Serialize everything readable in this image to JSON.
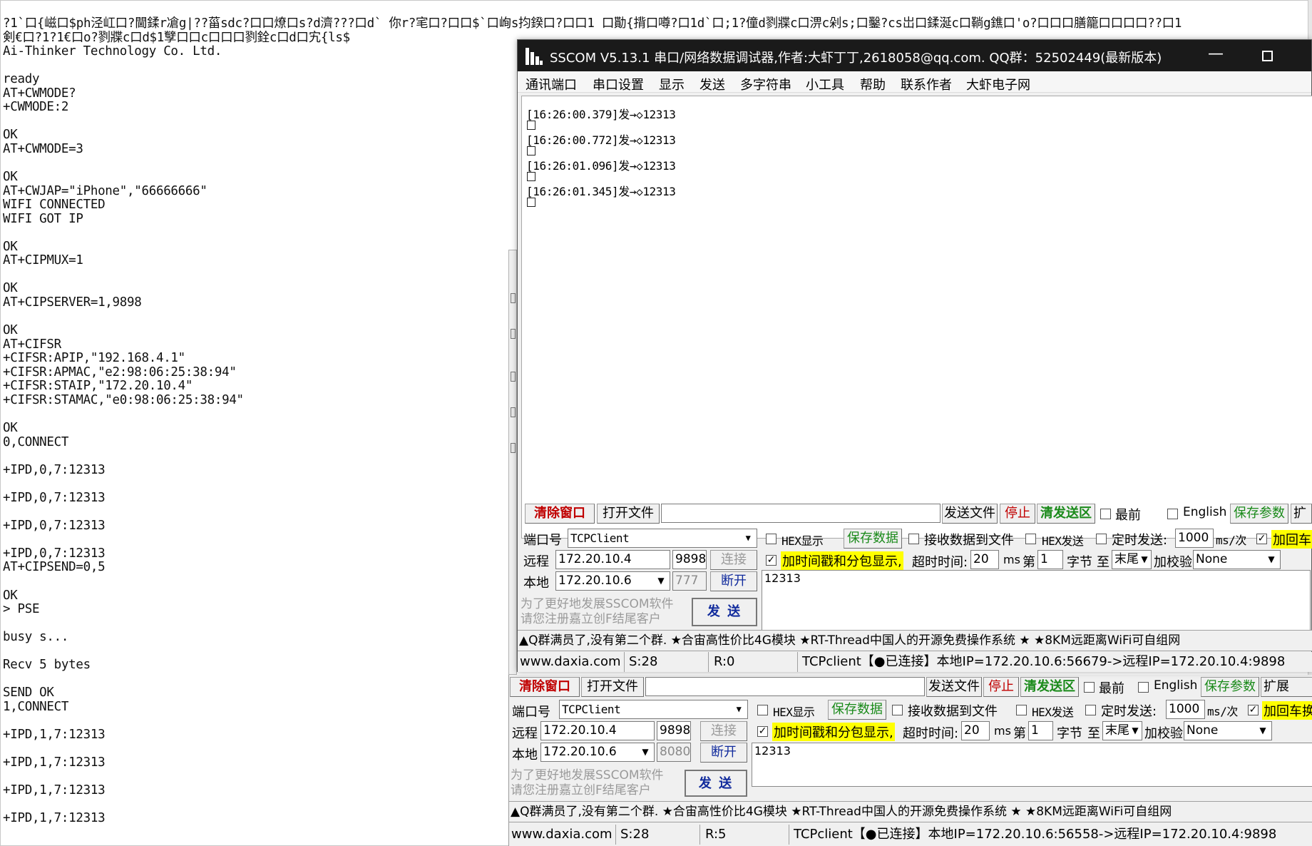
{
  "bg_log": {
    "lines": [
      "?1`口{嵫口$ph泾屸口?閫鍒r凔g|??菑sdc?口口燎口s?d濟???口d` 你r?宒口?口口$`口峋s抣鍨口?口口1 口勩{揹口噂?口1d`口;1?僮d剹牃c口淠c剁s;口鑿?cs岀口鍒涎c口鞝g鐎口'o?口口口膳籠口口口口??口1",
      "剣€口?1?1€口o?剹牃c口d$1孼口口c口口口剹銓c口d口宄{ls$",
      "Ai-Thinker Technology Co. Ltd.",
      "",
      "ready",
      "AT+CWMODE?",
      "+CWMODE:2",
      "",
      "OK",
      "AT+CWMODE=3",
      "",
      "OK",
      "AT+CWJAP=\"iPhone\",\"66666666\"",
      "WIFI CONNECTED",
      "WIFI GOT IP",
      "",
      "OK",
      "AT+CIPMUX=1",
      "",
      "OK",
      "AT+CIPSERVER=1,9898",
      "",
      "OK",
      "AT+CIFSR",
      "+CIFSR:APIP,\"192.168.4.1\"",
      "+CIFSR:APMAC,\"e2:98:06:25:38:94\"",
      "+CIFSR:STAIP,\"172.20.10.4\"",
      "+CIFSR:STAMAC,\"e0:98:06:25:38:94\"",
      "",
      "OK",
      "0,CONNECT",
      "",
      "+IPD,0,7:12313",
      "",
      "+IPD,0,7:12313",
      "",
      "+IPD,0,7:12313",
      "",
      "+IPD,0,7:12313",
      "AT+CIPSEND=0,5",
      "",
      "OK",
      "> PSE",
      "",
      "busy s...",
      "",
      "Recv 5 bytes",
      "",
      "SEND OK",
      "1,CONNECT",
      "",
      "+IPD,1,7:12313",
      "",
      "+IPD,1,7:12313",
      "",
      "+IPD,1,7:12313",
      "",
      "+IPD,1,7:12313"
    ]
  },
  "sscom": {
    "title": "SSCOM V5.13.1 串口/网络数据调试器,作者:大虾丁丁,2618058@qq.com. QQ群：52502449(最新版本)",
    "minimize_glyph": "—",
    "menu": [
      "通讯端口",
      "串口设置",
      "显示",
      "发送",
      "多字符串",
      "小工具",
      "帮助",
      "联系作者",
      "大虾电子网"
    ],
    "recv_lines": [
      "[16:26:00.379]发→◇12313",
      "[16:26:00.772]发→◇12313",
      "[16:26:01.096]发→◇12313",
      "[16:26:01.345]发→◇12313"
    ],
    "clear_label": "清除窗口",
    "open_file_label": "打开文件",
    "send_file_label": "发送文件",
    "stop_label": "停止",
    "clear_send_label": "清发送区",
    "topmost_label": "最前",
    "english_label": "English",
    "save_params_label": "保存参数",
    "expand_label": "扩",
    "port_label": "端口号",
    "port_value": "TCPClient",
    "hex_show_label": "HEX显示",
    "save_data_label": "保存数据",
    "recv_to_file_label": "接收数据到文件",
    "hex_send_label": "HEX发送",
    "timed_send_label": "定时发送:",
    "interval_value": "1000",
    "interval_unit": "ms/次",
    "add_crlf_label": "加回车",
    "remote_label": "远程",
    "remote_ip": "172.20.10.4",
    "remote_port": "9898",
    "connect_label": "连接",
    "timestamp_label": "加时间戳和分包显示,",
    "timeout_label": "超时时间:",
    "timeout_value": "20",
    "timeout_unit": "ms",
    "nth_label": "第",
    "nth_value": "1",
    "byte_label": "字节",
    "to_label": "至",
    "end_value": "末尾",
    "checksum_label": "加校验",
    "checksum_value": "None",
    "local_label": "本地",
    "local_ip": "172.20.10.6",
    "local_port": "777",
    "disconnect_label": "断开",
    "send_text": "12313",
    "ad_line1": "为了更好地发展SSCOM软件",
    "ad_line2": "请您注册嘉立创F结尾客户",
    "send_label": "发 送",
    "news": "▲Q群满员了,没有第二个群. ★合宙高性价比4G模块 ★RT-Thread中国人的开源免费操作系统 ★ ★8KM远距离WiFi可自组网",
    "status_site": "www.daxia.com",
    "status_s": "S:28",
    "status_r": "R:0",
    "status_conn": "TCPclient【●已连接】本地IP=172.20.10.6:56679->远程IP=172.20.10.4:9898"
  },
  "lower": {
    "clear_label": "清除窗口",
    "open_file_label": "打开文件",
    "send_file_label": "发送文件",
    "stop_label": "停止",
    "clear_send_label": "清发送区",
    "topmost_label": "最前",
    "english_label": "English",
    "save_params_label": "保存参数",
    "expand_label": "扩展",
    "port_label": "端口号",
    "port_value": "TCPClient",
    "hex_show_label": "HEX显示",
    "save_data_label": "保存数据",
    "recv_to_file_label": "接收数据到文件",
    "hex_send_label": "HEX发送",
    "timed_send_label": "定时发送:",
    "interval_value": "1000",
    "interval_unit": "ms/次",
    "add_crlf_label": "加回车换",
    "remote_label": "远程",
    "remote_ip": "172.20.10.4",
    "remote_port": "9898",
    "connect_label": "连接",
    "timestamp_label": "加时间戳和分包显示,",
    "timeout_label": "超时时间:",
    "timeout_value": "20",
    "timeout_unit": "ms",
    "nth_label": "第",
    "nth_value": "1",
    "byte_label": "字节",
    "to_label": "至",
    "end_value": "末尾",
    "checksum_label": "加校验",
    "checksum_value": "None",
    "local_label": "本地",
    "local_ip": "172.20.10.6",
    "local_port": "8080",
    "disconnect_label": "断开",
    "send_text": "12313",
    "ad_line1": "为了更好地发展SSCOM软件",
    "ad_line2": "请您注册嘉立创F结尾客户",
    "send_label": "发 送",
    "news": "▲Q群满员了,没有第二个群. ★合宙高性价比4G模块 ★RT-Thread中国人的开源免费操作系统 ★ ★8KM远距离WiFi可自组网",
    "status_site": "www.daxia.com",
    "status_s": "S:28",
    "status_r": "R:5",
    "status_conn": "TCPclient【●已连接】本地IP=172.20.10.6:56558->远程IP=172.20.10.4:9898"
  },
  "colors": {
    "titlebar": "#1a1a1a",
    "highlight_yellow": "#ffff00",
    "red_text": "#c00000",
    "green_text": "#1a8a1a",
    "navy_text": "#102a9c"
  }
}
